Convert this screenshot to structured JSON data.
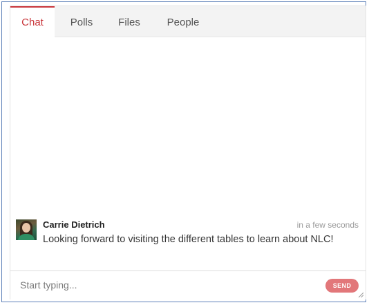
{
  "tabs": [
    {
      "label": "Chat",
      "active": true
    },
    {
      "label": "Polls",
      "active": false
    },
    {
      "label": "Files",
      "active": false
    },
    {
      "label": "People",
      "active": false
    }
  ],
  "message": {
    "author": "Carrie Dietrich",
    "timestamp": "in a few seconds",
    "text": "Looking forward to visiting the different tables to learn about NLC!",
    "avatar_icon": "user-avatar-photo"
  },
  "composer": {
    "placeholder": "Start typing...",
    "value": "",
    "send_label": "SEND"
  },
  "colors": {
    "accent": "#c9353a",
    "send_button": "#e2777a",
    "tab_bar": "#f3f3f3"
  }
}
